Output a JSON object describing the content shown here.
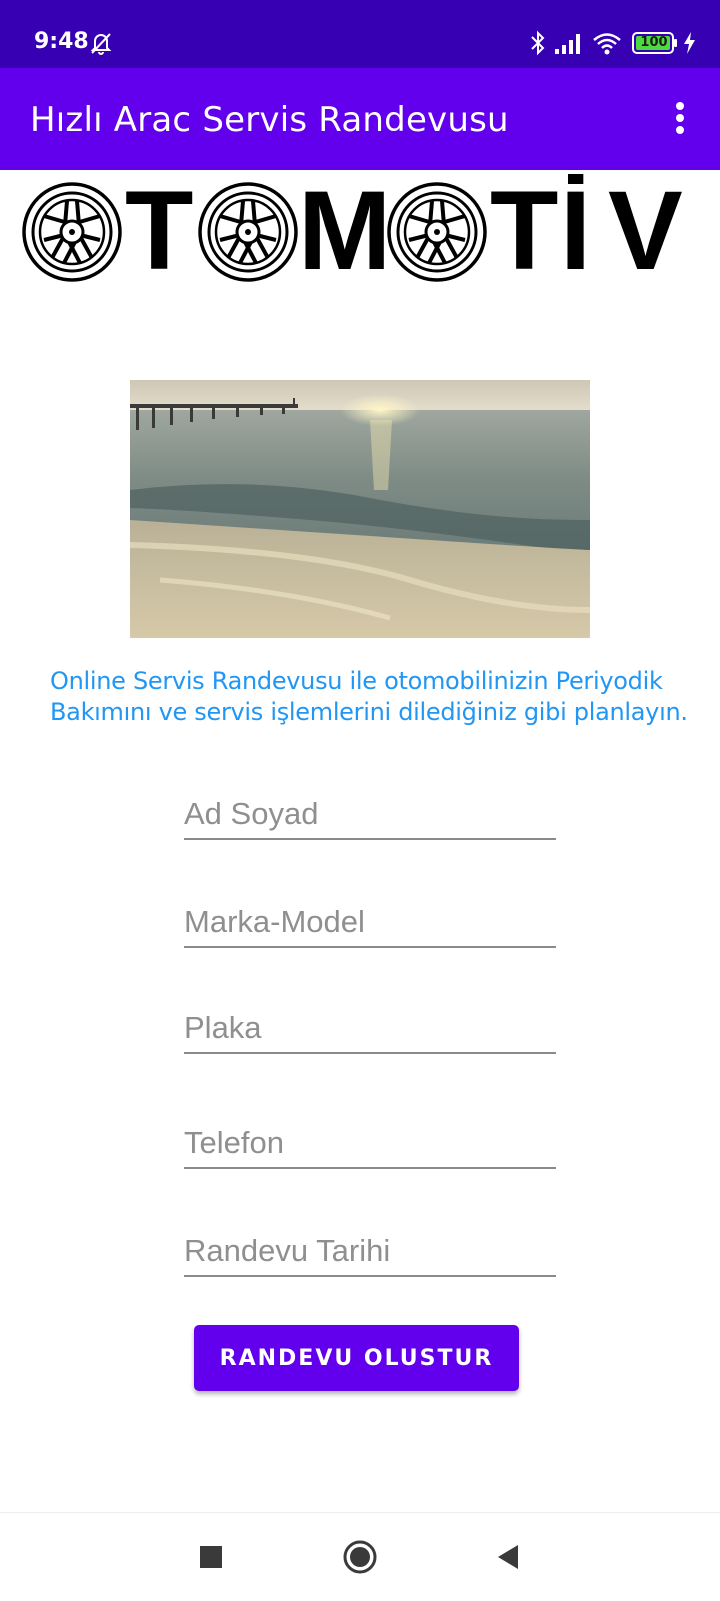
{
  "status_bar": {
    "time": "9:48",
    "battery": "100",
    "icons": [
      "alarm-off-icon",
      "bluetooth-icon",
      "signal-icon",
      "wifi-icon",
      "battery-icon",
      "charging-icon"
    ],
    "background": "#3700b3"
  },
  "app_bar": {
    "title": "Hızlı Arac Servis Randevusu",
    "overflow_icon": "more-vert-icon",
    "background": "#6200ee"
  },
  "logo": {
    "text": "OTOMOTİV",
    "letters": [
      "T",
      "M",
      "T",
      "İ",
      "V"
    ]
  },
  "hero_image": {
    "subject": "sea-shore-with-pier-at-sunset"
  },
  "description": {
    "line1": "Online Servis Randevusu ile otomobilinizin Periyodik",
    "line2": "Bakımını ve servis işlemlerini dilediğiniz gibi planlayın.",
    "color": "#2196f3"
  },
  "form": {
    "name_placeholder": "Ad Soyad",
    "brand_placeholder": "Marka-Model",
    "plate_placeholder": "Plaka",
    "phone_placeholder": "Telefon",
    "date_placeholder": "Randevu Tarihi",
    "submit_label": "RANDEVU OLUSTUR"
  },
  "nav_bar": {
    "icons": [
      "recents-square-icon",
      "home-circle-icon",
      "back-triangle-icon"
    ]
  }
}
